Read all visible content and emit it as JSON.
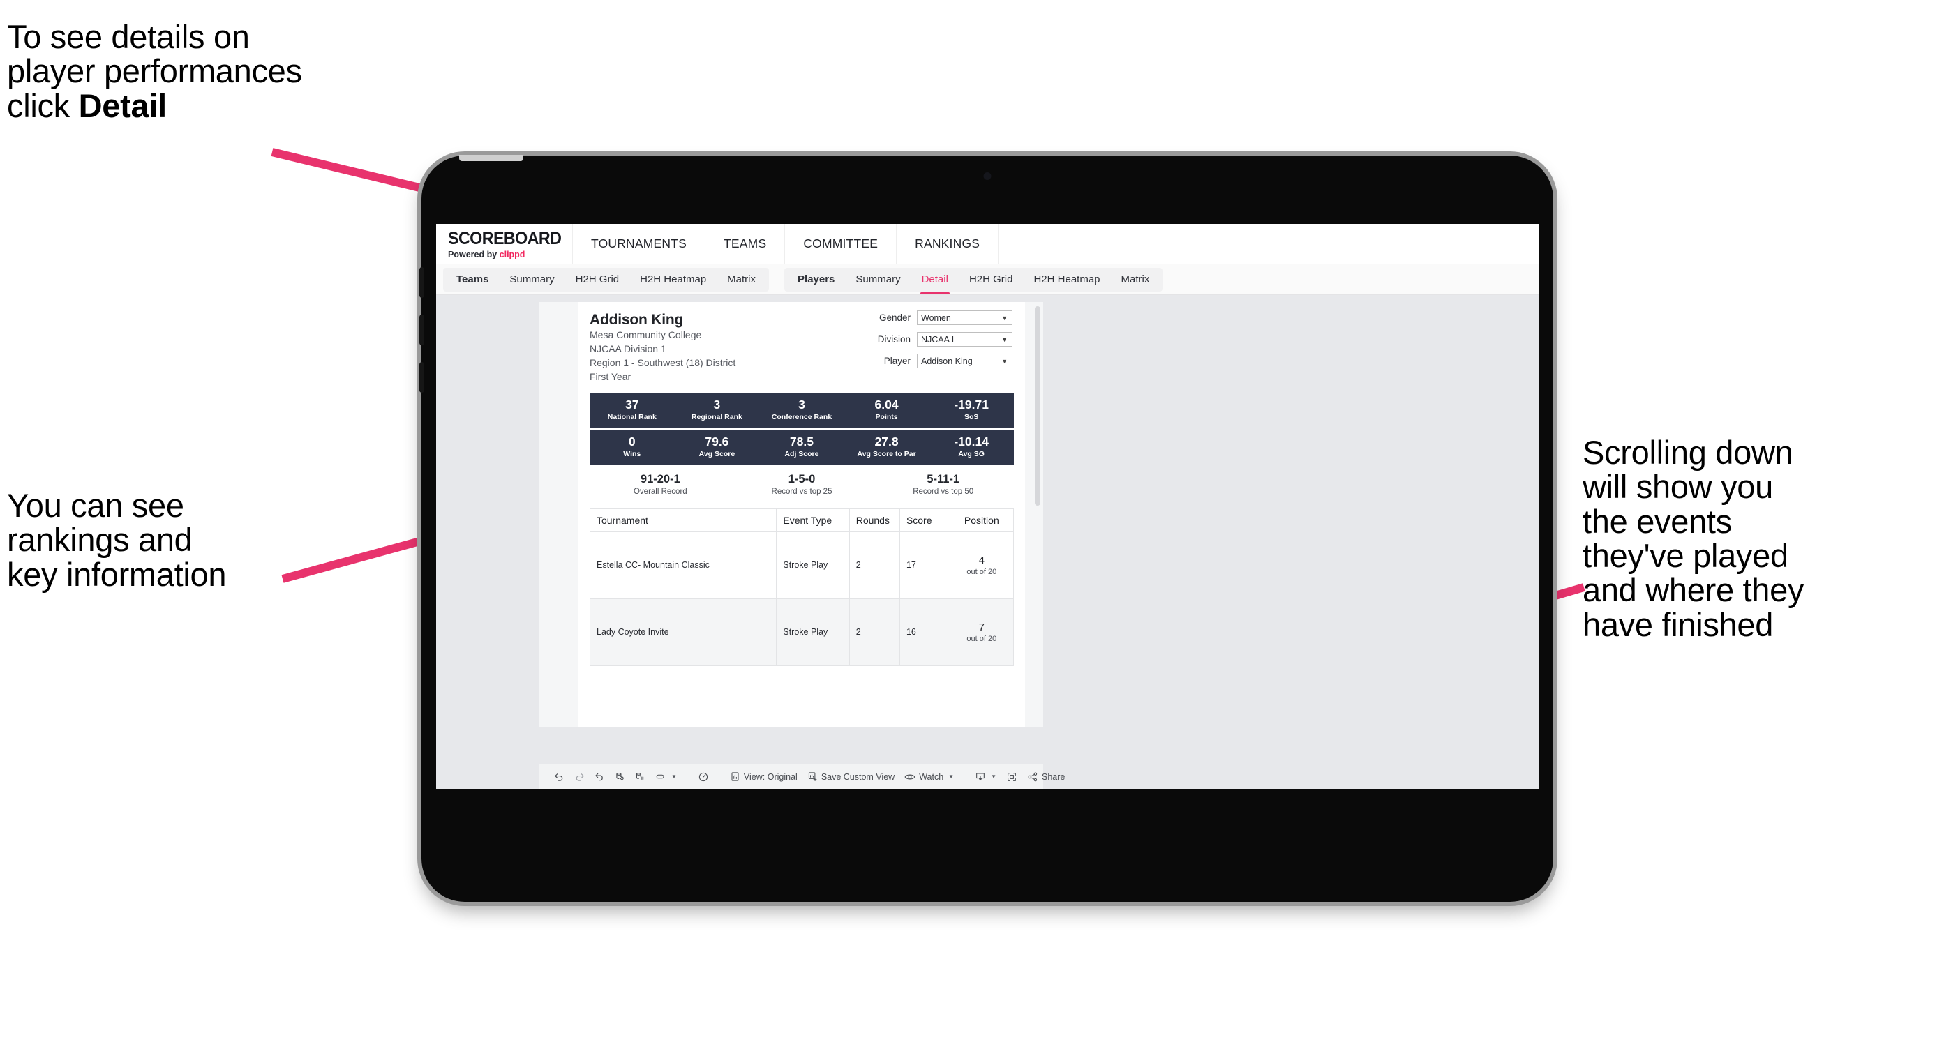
{
  "annotations": {
    "top_left": "To see details on\nplayer performances\nclick ",
    "top_left_bold": "Detail",
    "mid_left": "You can see\nrankings and\nkey information",
    "right": "Scrolling down\nwill show you\nthe events\nthey've played\nand where they\nhave finished",
    "arrow_color": "#e8336d"
  },
  "app": {
    "brand": {
      "word": "SCOREBOARD",
      "powered_prefix": "Powered by ",
      "powered_name": "clippd"
    },
    "top_nav": [
      "TOURNAMENTS",
      "TEAMS",
      "COMMITTEE",
      "RANKINGS"
    ],
    "sub_nav": {
      "group_teams": [
        "Teams",
        "Summary",
        "H2H Grid",
        "H2H Heatmap",
        "Matrix"
      ],
      "group_players": [
        "Players",
        "Summary",
        "Detail",
        "H2H Grid",
        "H2H Heatmap",
        "Matrix"
      ],
      "active": "Detail"
    },
    "accent": "#e8336d",
    "stat_bar_bg": "#2e3549"
  },
  "player": {
    "name": "Addison King",
    "school": "Mesa Community College",
    "division": "NJCAA Division 1",
    "region": "Region 1 - Southwest (18) District",
    "year": "First Year"
  },
  "filters": [
    {
      "label": "Gender",
      "value": "Women"
    },
    {
      "label": "Division",
      "value": "NJCAA I"
    },
    {
      "label": "Player",
      "value": "Addison King"
    }
  ],
  "stats_row_1": [
    {
      "value": "37",
      "label": "National Rank"
    },
    {
      "value": "3",
      "label": "Regional Rank"
    },
    {
      "value": "3",
      "label": "Conference Rank"
    },
    {
      "value": "6.04",
      "label": "Points"
    },
    {
      "value": "-19.71",
      "label": "SoS"
    }
  ],
  "stats_row_2": [
    {
      "value": "0",
      "label": "Wins"
    },
    {
      "value": "79.6",
      "label": "Avg Score"
    },
    {
      "value": "78.5",
      "label": "Adj Score"
    },
    {
      "value": "27.8",
      "label": "Avg Score to Par"
    },
    {
      "value": "-10.14",
      "label": "Avg SG"
    }
  ],
  "records": [
    {
      "value": "91-20-1",
      "label": "Overall Record"
    },
    {
      "value": "1-5-0",
      "label": "Record vs top 25"
    },
    {
      "value": "5-11-1",
      "label": "Record vs top 50"
    }
  ],
  "events_table": {
    "columns": [
      "Tournament",
      "Event Type",
      "Rounds",
      "Score",
      "Position"
    ],
    "rows": [
      {
        "tournament": "Estella CC- Mountain Classic",
        "event_type": "Stroke Play",
        "rounds": "2",
        "score": "17",
        "position": "4",
        "position_of": "out of 20"
      },
      {
        "tournament": "Lady Coyote Invite",
        "event_type": "Stroke Play",
        "rounds": "2",
        "score": "16",
        "position": "7",
        "position_of": "out of 20"
      }
    ]
  },
  "toolbar": {
    "view_label": "View: Original",
    "save_label": "Save Custom View",
    "watch_label": "Watch",
    "share_label": "Share"
  }
}
